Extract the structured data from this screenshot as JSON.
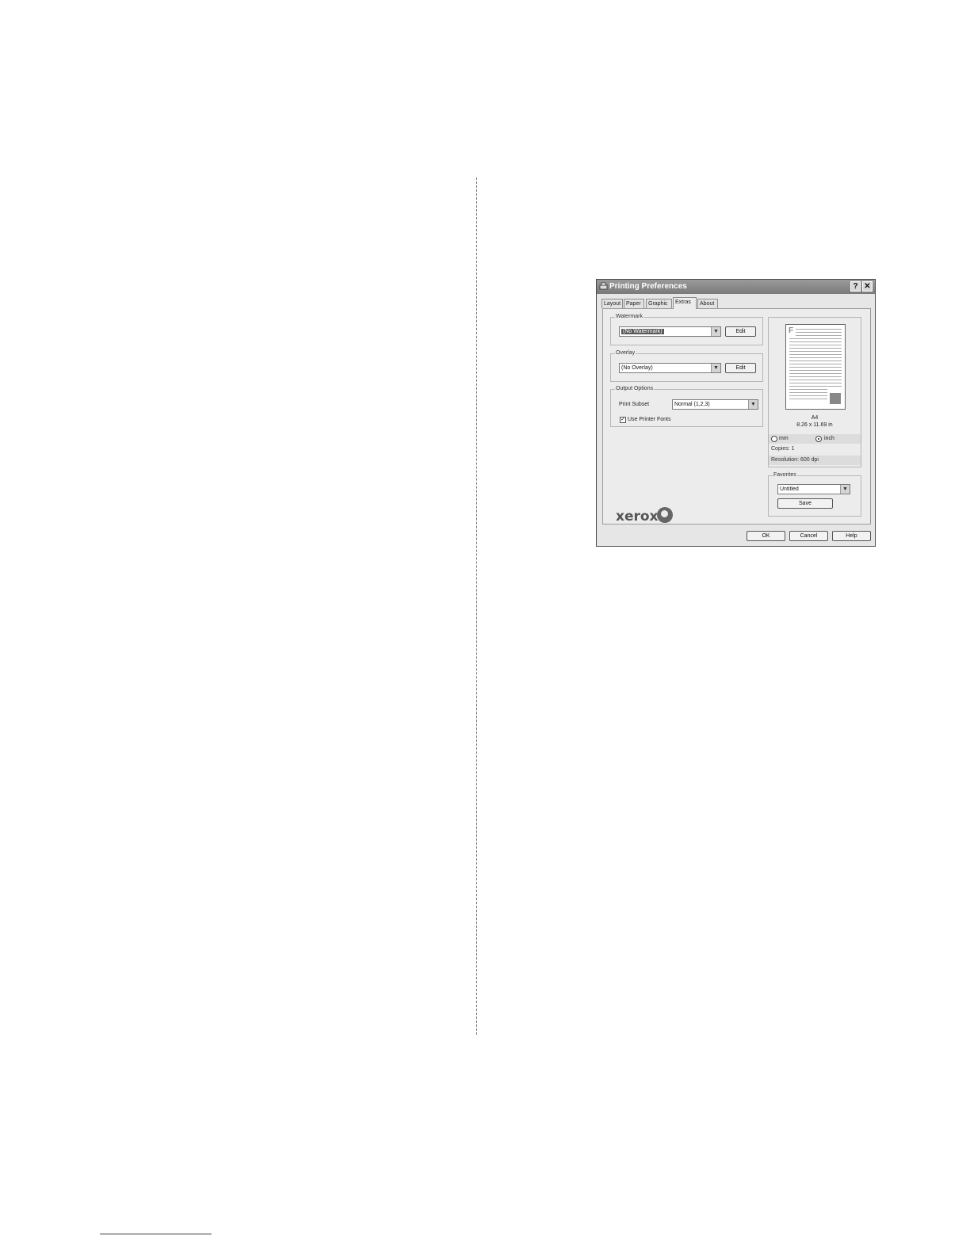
{
  "dialog": {
    "title": "Printing Preferences",
    "help_button": "?",
    "close_button": "✕",
    "tabs": [
      {
        "label": "Layout"
      },
      {
        "label": "Paper"
      },
      {
        "label": "Graphic"
      },
      {
        "label": "Extras",
        "active": true
      },
      {
        "label": "About"
      }
    ],
    "watermark": {
      "group_label": "Watermark",
      "selected": "(No Watermark)",
      "edit_label": "Edit"
    },
    "overlay": {
      "group_label": "Overlay",
      "selected": "(No Overlay)",
      "edit_label": "Edit"
    },
    "output_options": {
      "group_label": "Output Options",
      "print_subset_label": "Print Subset",
      "print_subset_value": "Normal (1,2,3)",
      "use_printer_fonts_label": "Use Printer Fonts",
      "use_printer_fonts_checked": true
    },
    "preview": {
      "paper_letter": "F",
      "paper_size": "A4",
      "paper_dims": "8.26 x 11.69 in",
      "unit_mm": "mm",
      "unit_inch": "inch",
      "selected_unit": "inch",
      "copies": "Copies: 1",
      "resolution": "Resolution: 600 dpi"
    },
    "favorites": {
      "group_label": "Favorites",
      "selected": "Untitled",
      "save_label": "Save"
    },
    "logo_text": "xerox",
    "footer": {
      "ok_label": "OK",
      "cancel_label": "Cancel",
      "help_label": "Help"
    }
  }
}
